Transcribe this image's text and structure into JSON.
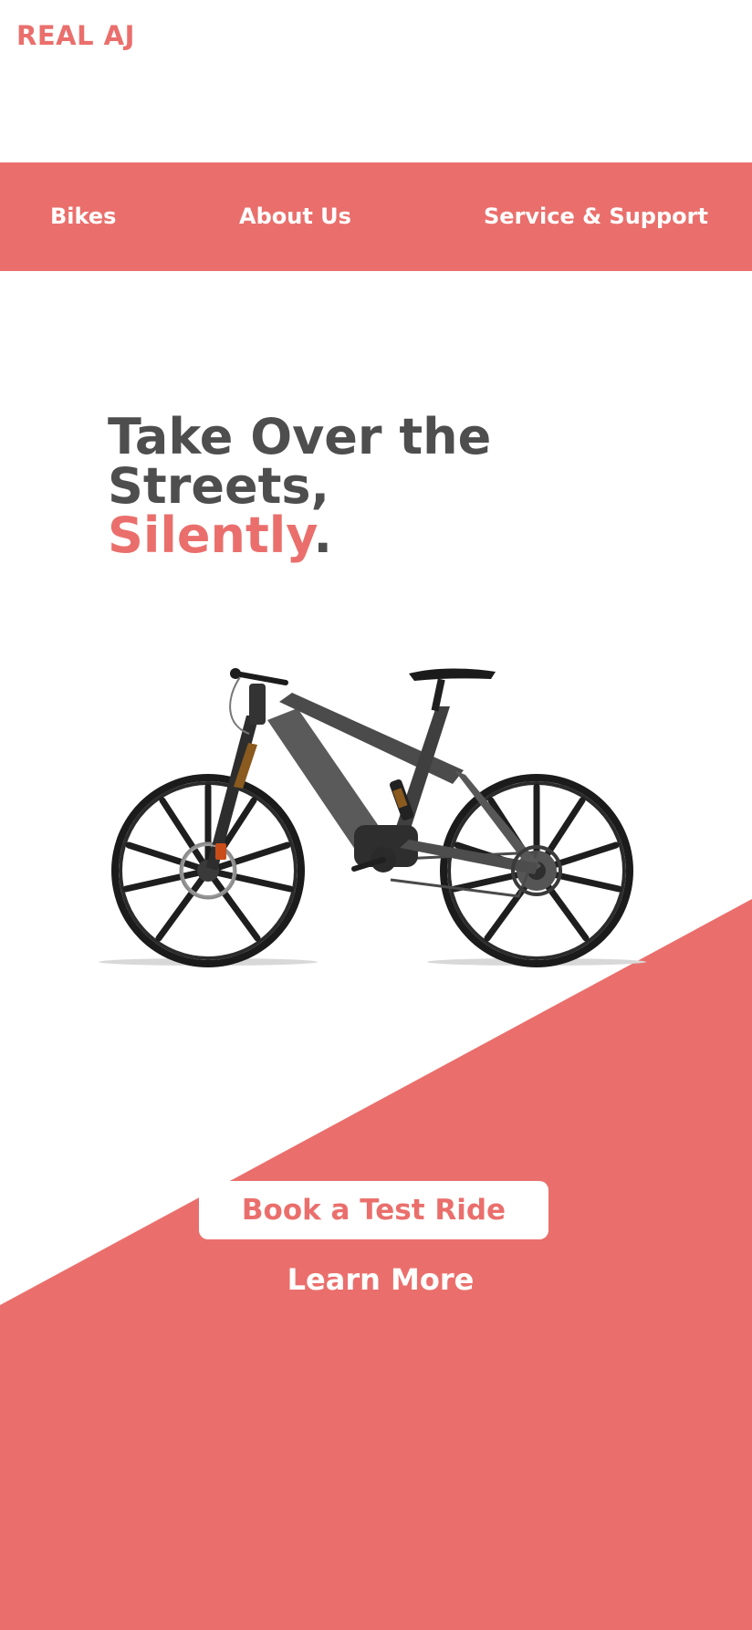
{
  "brand": {
    "logo": "REAL AJ"
  },
  "colors": {
    "accent": "#ea6f6c",
    "headline": "#4e4e4e",
    "white": "#ffffff"
  },
  "nav": {
    "items": [
      {
        "label": "Bikes"
      },
      {
        "label": "About Us"
      },
      {
        "label": "Service & Support"
      }
    ]
  },
  "hero": {
    "headline_part1": "Take Over the Streets,",
    "headline_accent": "Silently",
    "headline_end": ".",
    "image": "e-mountain-bike"
  },
  "cta": {
    "primary_label": "Book a Test Ride",
    "secondary_label": "Learn More"
  }
}
